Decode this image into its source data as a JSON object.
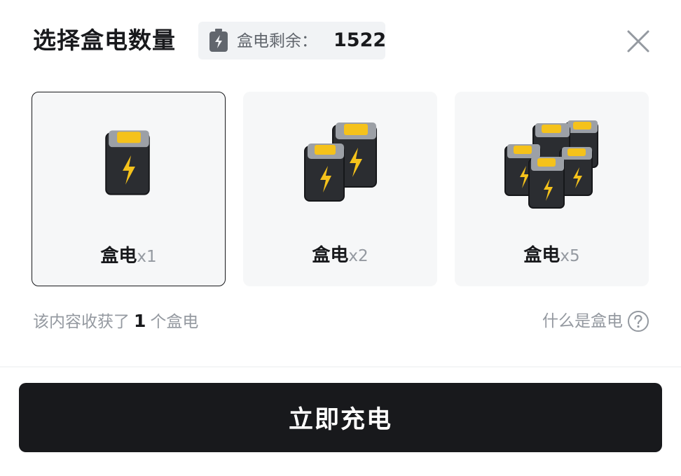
{
  "header": {
    "title": "选择盒电数量",
    "balance_label": "盒电剩余：",
    "balance_value": "1522"
  },
  "options": [
    {
      "name": "盒电",
      "qty": "x1",
      "selected": true
    },
    {
      "name": "盒电",
      "qty": "x2",
      "selected": false
    },
    {
      "name": "盒电",
      "qty": "x5",
      "selected": false
    }
  ],
  "info": {
    "prefix": "该内容收获了",
    "count": "1",
    "suffix": "个盒电"
  },
  "help": {
    "label": "什么是盒电"
  },
  "action": {
    "label": "立即充电"
  },
  "colors": {
    "primary": "#18191c",
    "muted": "#9499a0",
    "card_bg": "#f6f7f8",
    "battery_yellow": "#f5c21b"
  },
  "icons": [
    "battery-bolt-icon",
    "close-icon",
    "question-circle-icon"
  ]
}
